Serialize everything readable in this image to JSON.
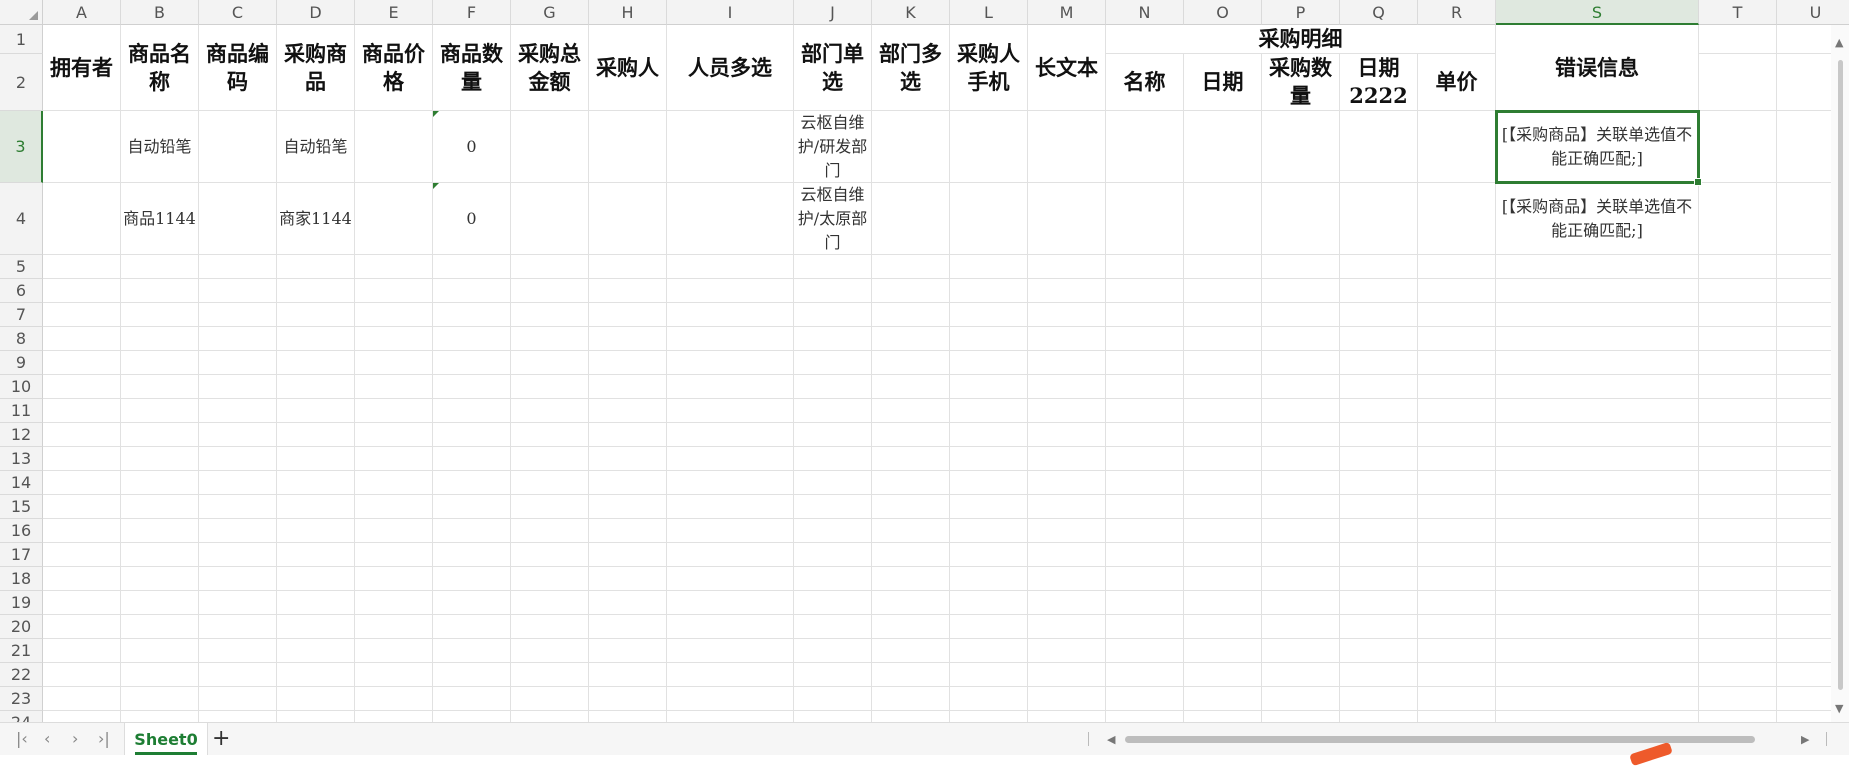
{
  "spreadsheet": {
    "columns": [
      "A",
      "B",
      "C",
      "D",
      "E",
      "F",
      "G",
      "H",
      "I",
      "J",
      "K",
      "L",
      "M",
      "N",
      "O",
      "P",
      "Q",
      "R",
      "S",
      "T",
      "U"
    ],
    "rows": [
      "1",
      "2",
      "3",
      "4",
      "5",
      "6",
      "7",
      "8",
      "9",
      "10",
      "11",
      "12",
      "13",
      "14",
      "15",
      "16",
      "17",
      "18",
      "19",
      "20",
      "21",
      "22",
      "23",
      "24"
    ],
    "selected_column": "S",
    "selected_row": "3",
    "headers": {
      "owner": "拥有者",
      "product_name": "商品名称",
      "product_code": "商品编码",
      "purchase_product": "采购商品",
      "product_price": "商品价格",
      "product_qty": "商品数量",
      "purchase_total": "采购总金额",
      "purchaser": "采购人",
      "person_multi": "人员多选",
      "dept_single": "部门单选",
      "dept_multi": "部门多选",
      "purchaser_phone": "采购人手机",
      "long_text": "长文本",
      "purchase_detail": "采购明细",
      "detail_name": "名称",
      "detail_date": "日期",
      "detail_qty": "采购数量",
      "detail_date2222": "日期2222",
      "detail_unit_price": "单价",
      "error_info": "错误信息"
    },
    "data_rows": [
      {
        "product_name": "自动铅笔",
        "purchase_product": "自动铅笔",
        "product_qty": "0",
        "dept_single": "云枢自维护/研发部门",
        "error_info": "[【采购商品】关联单选值不能正确匹配;]"
      },
      {
        "product_name": "商品1144",
        "purchase_product": "商家1144",
        "product_qty": "0",
        "dept_single": "云枢自维护/太原部门",
        "error_info": "[【采购商品】关联单选值不能正确匹配;]"
      }
    ]
  },
  "sheet_tabs": {
    "active": "Sheet0",
    "add_label": "+"
  },
  "colors": {
    "accent": "#2e7d32",
    "tab_text": "#1e7e34"
  }
}
